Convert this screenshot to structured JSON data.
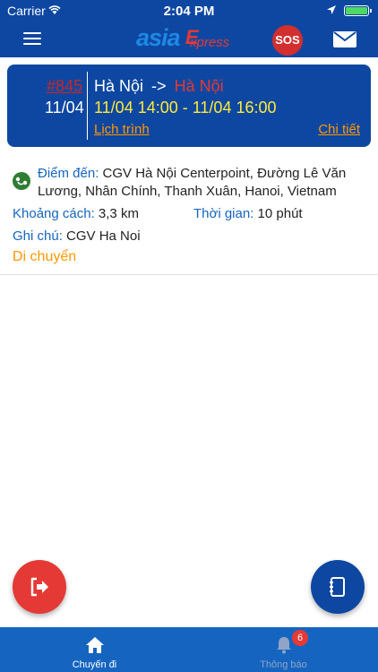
{
  "status_bar": {
    "carrier": "Carrier",
    "time": "2:04 PM"
  },
  "header": {
    "logo_text": "asia",
    "logo_express": "xpress",
    "logo_e": "E",
    "sos_label": "SOS"
  },
  "trip": {
    "id": "#845",
    "date": "11/04",
    "from": "Hà Nội",
    "arrow": "->",
    "to": "Hà Nội",
    "time_range": "11/04 14:00 - 11/04 16:00",
    "schedule_link": "Lịch trình",
    "detail_link": "Chi tiết"
  },
  "info": {
    "destination_label": "Điểm đến:",
    "destination_value": "CGV Hà Nội Centerpoint, Đường Lê Văn Lương, Nhân Chính, Thanh Xuân, Hanoi, Vietnam",
    "distance_label": "Khoảng cách:",
    "distance_value": "3,3 km",
    "duration_label": "Thời gian:",
    "duration_value": "10 phút",
    "note_label": "Ghi chú:",
    "note_value": "CGV Ha Noi",
    "move_link": "Di chuyển"
  },
  "tabs": [
    {
      "label": "Chuyến đi",
      "icon": "home-icon",
      "active": true
    },
    {
      "label": "Thông báo",
      "icon": "bell-icon",
      "active": false,
      "badge": "6"
    }
  ],
  "colors": {
    "primary": "#0d47a1",
    "accent_orange": "#ff9800",
    "accent_red": "#e53935",
    "time_yellow": "#ffeb3b"
  }
}
